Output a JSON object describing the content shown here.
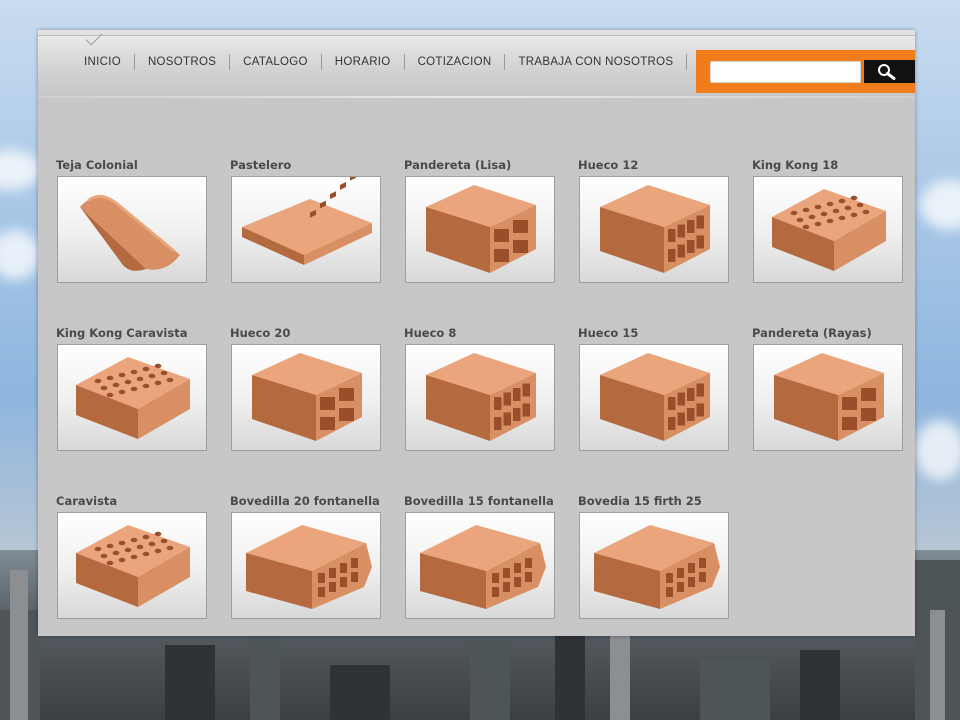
{
  "nav": {
    "items": [
      {
        "label": "INICIO"
      },
      {
        "label": "NOSOTROS"
      },
      {
        "label": "CATALOGO"
      },
      {
        "label": "HORARIO"
      },
      {
        "label": "COTIZACION"
      },
      {
        "label": "TRABAJA CON NOSOTROS"
      }
    ]
  },
  "search": {
    "value": "",
    "button_icon": "search-icon"
  },
  "catalog": {
    "products": [
      {
        "name": "Teja Colonial",
        "shape": "tile-icon"
      },
      {
        "name": "Pastelero",
        "shape": "flat-brick-icon"
      },
      {
        "name": "Pandereta (Lisa)",
        "shape": "hollow-brick-icon"
      },
      {
        "name": "Hueco 12",
        "shape": "hollow-block-icon"
      },
      {
        "name": "King Kong 18",
        "shape": "perforated-brick-icon"
      },
      {
        "name": "King Kong Caravista",
        "shape": "perforated-brick-icon"
      },
      {
        "name": "Hueco 20",
        "shape": "hollow-block-icon"
      },
      {
        "name": "Hueco 8",
        "shape": "hollow-block-icon"
      },
      {
        "name": "Hueco 15",
        "shape": "hollow-block-icon"
      },
      {
        "name": "Pandereta (Rayas)",
        "shape": "hollow-brick-icon"
      },
      {
        "name": "Caravista",
        "shape": "perforated-brick-icon"
      },
      {
        "name": "Bovedilla 20 fontanella",
        "shape": "vault-block-icon"
      },
      {
        "name": "Bovedilla 15 fontanella",
        "shape": "vault-block-icon"
      },
      {
        "name": "Bovedia 15 firth 25",
        "shape": "vault-block-icon"
      }
    ]
  },
  "colors": {
    "accent": "#f07c1c",
    "brick": "#d98f64",
    "panel": "#c7c7c7"
  }
}
